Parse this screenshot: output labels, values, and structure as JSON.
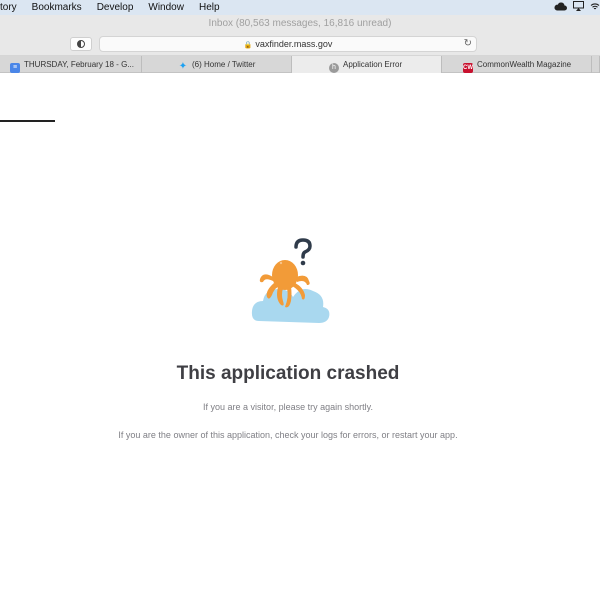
{
  "menubar": {
    "items": [
      "tory",
      "Bookmarks",
      "Develop",
      "Window",
      "Help"
    ],
    "icons": [
      "cloud-icon",
      "airplay-icon",
      "wifi-icon"
    ]
  },
  "window": {
    "title": "Inbox (80,563 messages, 16,816 unread)"
  },
  "toolbar": {
    "url": "vaxfinder.mass.gov"
  },
  "tabs": [
    {
      "label": "THURSDAY, February 18 - G...",
      "icon": "google-docs-icon",
      "active": false
    },
    {
      "label": "(6) Home / Twitter",
      "icon": "twitter-icon",
      "active": false
    },
    {
      "label": "Application Error",
      "icon": "heroku-icon",
      "active": true
    },
    {
      "label": "CommonWealth Magazine",
      "icon": "commonwealth-icon",
      "active": false
    }
  ],
  "error": {
    "title": "This application crashed",
    "visitor_message": "If you are a visitor, please try again shortly.",
    "owner_message": "If you are the owner of this application, check your logs for errors, or restart your app."
  },
  "colors": {
    "octopus": "#f29b38",
    "cloud": "#a9d8ef",
    "question_mark": "#2f3b4a",
    "headline": "#3f3f44",
    "body_text": "#7f7f85"
  }
}
